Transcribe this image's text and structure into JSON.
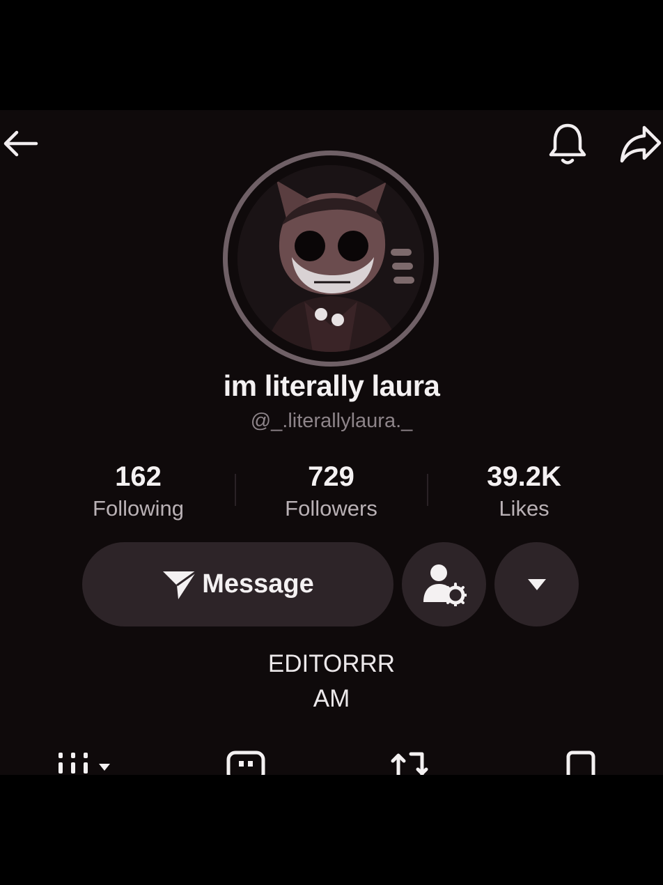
{
  "profile": {
    "display_name": "im literally laura",
    "username": "@_.literallylaura._",
    "avatar_icon": "avatar-image"
  },
  "header": {
    "back_icon": "back-arrow-icon",
    "bell_icon": "bell-icon",
    "share_icon": "share-arrow-icon"
  },
  "stats": [
    {
      "value": "162",
      "label": "Following"
    },
    {
      "value": "729",
      "label": "Followers"
    },
    {
      "value": "39.2K",
      "label": "Likes"
    }
  ],
  "actions": {
    "message_label": "Message",
    "message_icon": "send-icon",
    "friend_icon": "user-settings-icon",
    "more_icon": "caret-down-icon"
  },
  "bio": {
    "line1": "EDITORRR",
    "line2": "AM"
  },
  "tabs": [
    {
      "icon": "grid-icon"
    },
    {
      "icon": "lock-icon"
    },
    {
      "icon": "repost-icon"
    },
    {
      "icon": "bookmark-icon"
    }
  ],
  "colors": {
    "background": "#0f0a0b",
    "button": "#2d2428",
    "ring": "#6f6066",
    "username": "#8d8489"
  }
}
